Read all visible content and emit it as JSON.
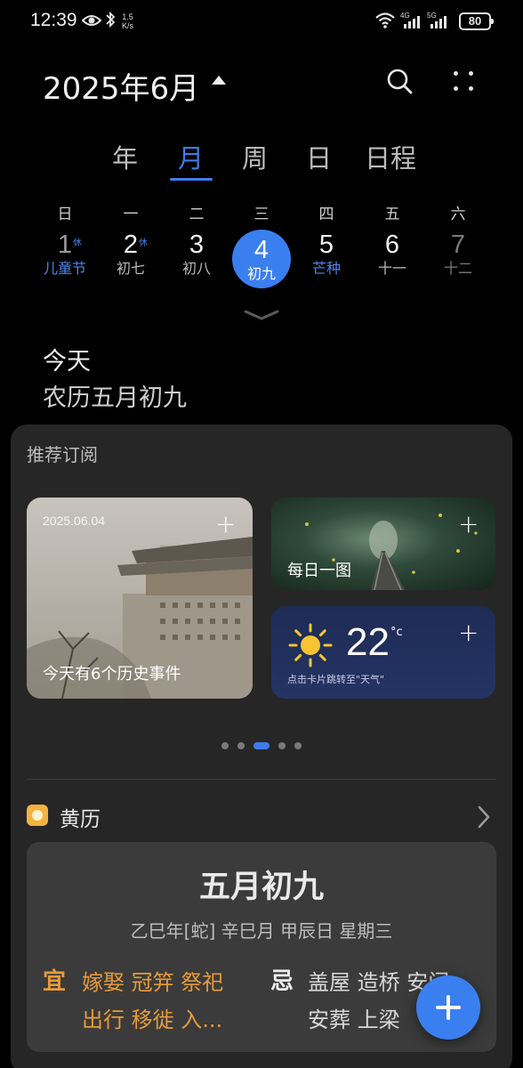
{
  "status_bar": {
    "time": "12:39",
    "speed_value": "1.5",
    "speed_unit": "K/s",
    "net1": "4G",
    "net2": "5G",
    "battery": "80"
  },
  "header": {
    "month_title": "2025年6月"
  },
  "view_tabs": [
    "年",
    "月",
    "周",
    "日",
    "日程"
  ],
  "active_tab": "月",
  "weekday_headers": [
    "日",
    "一",
    "二",
    "三",
    "四",
    "五",
    "六"
  ],
  "week_days": [
    {
      "day": "1",
      "lunar": "儿童节",
      "rest": "休",
      "festival": true
    },
    {
      "day": "2",
      "lunar": "初七",
      "rest": "休",
      "festival": false
    },
    {
      "day": "3",
      "lunar": "初八",
      "rest": "",
      "festival": false
    },
    {
      "day": "4",
      "lunar": "初九",
      "rest": "",
      "festival": false,
      "today": true
    },
    {
      "day": "5",
      "lunar": "芒种",
      "rest": "",
      "festival": true
    },
    {
      "day": "6",
      "lunar": "十一",
      "rest": "",
      "festival": false
    },
    {
      "day": "7",
      "lunar": "十二",
      "rest": "",
      "festival": false
    }
  ],
  "today": {
    "title": "今天",
    "lunar": "农历五月初九"
  },
  "subscriptions": {
    "title": "推荐订阅",
    "history_card": {
      "date": "2025.06.04",
      "caption": "今天有6个历史事件"
    },
    "photo_card": {
      "caption": "每日一图"
    },
    "weather_card": {
      "temperature": "22",
      "unit": "°c",
      "hint": "点击卡片跳转至\"天气\""
    },
    "page_count": 5,
    "active_page": 2
  },
  "almanac": {
    "title": "黄历",
    "date": "五月初九",
    "ganzhi": "乙巳年[蛇]  辛巳月 甲辰日 星期三",
    "yi_label": "宜",
    "yi_line1": "嫁娶 冠笄 祭祀",
    "yi_line2": "出行 移徙 入...",
    "ji_label": "忌",
    "ji_line1": "盖屋 造桥 安门",
    "ji_line2": "安葬 上梁"
  },
  "colors": {
    "accent": "#3f7bea",
    "almanac_yi": "#e79b3a",
    "almanac_icon": "#f3b33d"
  }
}
